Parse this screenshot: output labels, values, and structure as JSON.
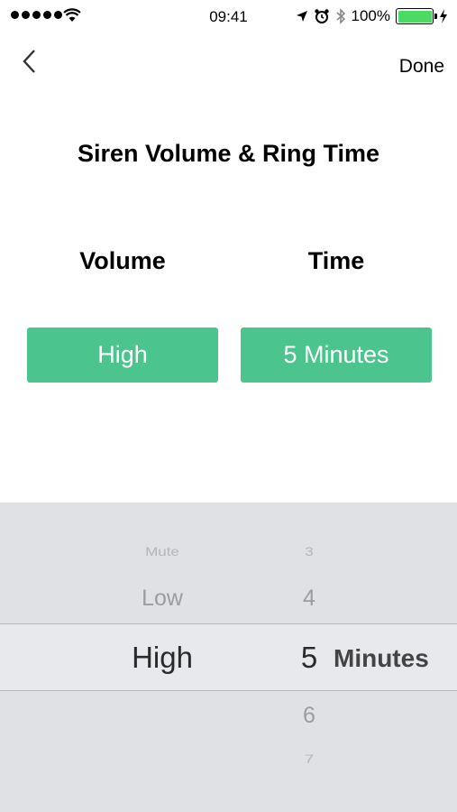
{
  "status_bar": {
    "time": "09:41",
    "battery_text": "100%",
    "battery_color": "#4cd964",
    "icons": [
      "signal-icon",
      "wifi-icon",
      "location-icon",
      "alarm-icon",
      "bluetooth-icon",
      "battery-icon",
      "charging-icon"
    ]
  },
  "nav": {
    "back_icon": "chevron-left-icon",
    "done_label": "Done"
  },
  "page": {
    "title": "Siren Volume & Ring Time"
  },
  "settings": {
    "volume_label": "Volume",
    "time_label": "Time",
    "volume_value": "High",
    "time_value": "5 Minutes",
    "accent_color": "#4bc48e"
  },
  "picker": {
    "volume_options": [
      "Mute",
      "Low",
      "High"
    ],
    "selected_volume": "High",
    "minute_options": [
      "3",
      "4",
      "5",
      "6",
      "7"
    ],
    "selected_minutes": "5",
    "unit_label": "Minutes"
  }
}
